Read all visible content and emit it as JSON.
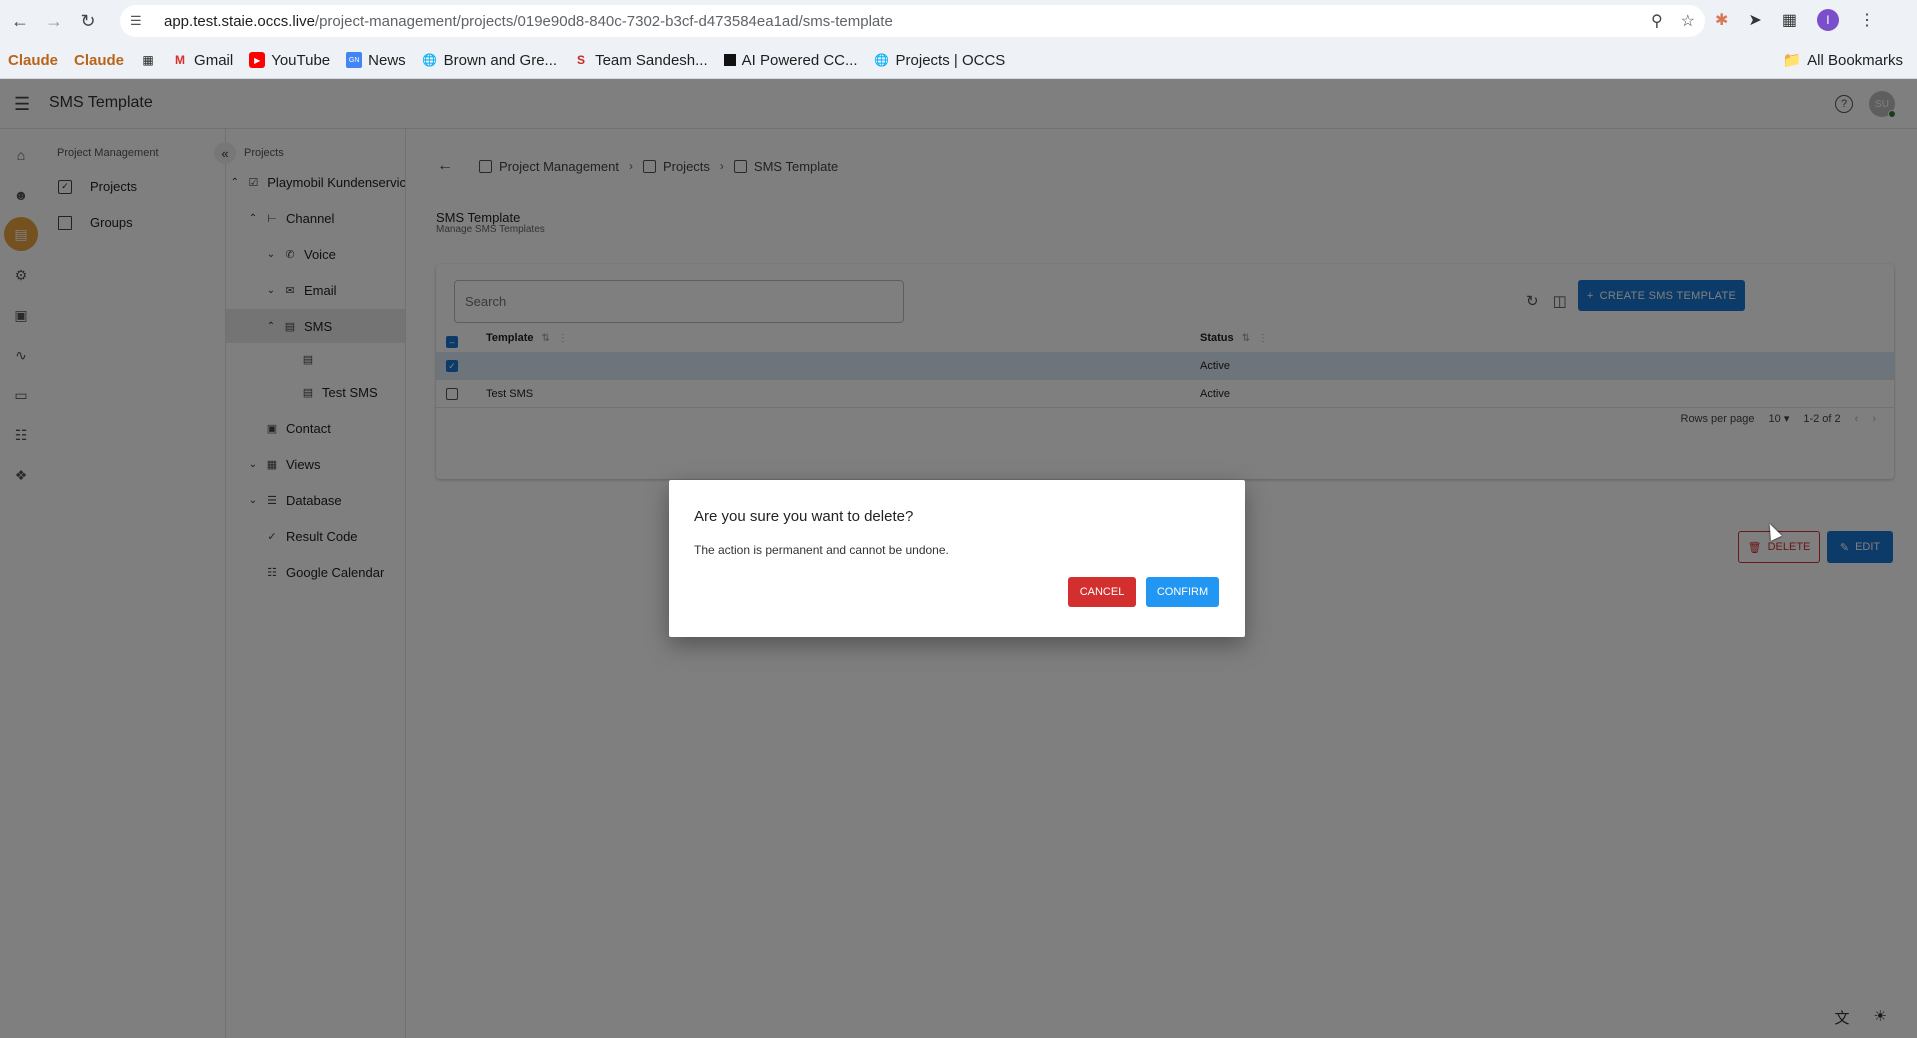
{
  "browser": {
    "url_domain": "app.test.staie.occs.live",
    "url_path": "/project-management/projects/019e90d8-840c-7302-b3cf-d473584ea1ad/sms-template",
    "profile_initial": "I",
    "bookmarks": [
      {
        "label": "Claude",
        "icon": "claude-icon"
      },
      {
        "label": "Claude",
        "icon": "claude-icon"
      },
      {
        "label": "",
        "icon": "apps-grid-icon"
      },
      {
        "label": "Gmail",
        "icon": "gmail-icon"
      },
      {
        "label": "YouTube",
        "icon": "youtube-icon"
      },
      {
        "label": "News",
        "icon": "news-icon"
      },
      {
        "label": "Brown and Gre...",
        "icon": "globe-icon"
      },
      {
        "label": "Team Sandesh...",
        "icon": "sandesh-icon"
      },
      {
        "label": "AI Powered CC...",
        "icon": "black-square-icon"
      },
      {
        "label": "Projects | OCCS",
        "icon": "globe-icon"
      }
    ],
    "all_bookmarks": "All Bookmarks"
  },
  "app": {
    "title": "SMS Template",
    "avatar_initials": "SU"
  },
  "pm_panel": {
    "heading": "Project Management",
    "items": [
      {
        "label": "Projects",
        "icon": "checkbox-icon"
      },
      {
        "label": "Groups",
        "icon": "folder-icon"
      }
    ]
  },
  "tree": {
    "heading": "Projects",
    "rows": [
      {
        "label": "Playmobil Kundenservic",
        "chev": "^",
        "icon": "checkbox-icon"
      },
      {
        "label": "Channel",
        "chev": "^",
        "icon": "channel-icon"
      },
      {
        "label": "Voice",
        "chev": "v",
        "icon": "phone-icon"
      },
      {
        "label": "Email",
        "chev": "v",
        "icon": "mail-icon"
      },
      {
        "label": "SMS",
        "chev": "^",
        "icon": "sms-icon"
      },
      {
        "label": "",
        "chev": "",
        "icon": "sms-icon"
      },
      {
        "label": "Test SMS",
        "chev": "",
        "icon": "sms-icon"
      },
      {
        "label": "Contact",
        "chev": "",
        "icon": "contact-icon"
      },
      {
        "label": "Views",
        "chev": "v",
        "icon": "grid-icon"
      },
      {
        "label": "Database",
        "chev": "v",
        "icon": "list-icon"
      },
      {
        "label": "Result Code",
        "chev": "",
        "icon": "check-icon"
      },
      {
        "label": "Google Calendar",
        "chev": "",
        "icon": "calendar-icon"
      }
    ]
  },
  "breadcrumb": {
    "items": [
      "Project Management",
      "Projects",
      "SMS Template"
    ]
  },
  "page": {
    "title": "SMS Template",
    "subtitle": "Manage SMS Templates"
  },
  "table": {
    "search_placeholder": "Search",
    "create_label": "CREATE SMS TEMPLATE",
    "columns": [
      "Template",
      "Status"
    ],
    "rows": [
      {
        "template": "",
        "status": "Active",
        "selected": true
      },
      {
        "template": "Test SMS",
        "status": "Active",
        "selected": false
      }
    ],
    "rows_per_page_label": "Rows per page",
    "rows_per_page": "10",
    "range": "1-2 of 2"
  },
  "actions": {
    "delete_label": "DELETE",
    "edit_label": "EDIT"
  },
  "dialog": {
    "title": "Are you sure you want to delete?",
    "body": "The action is permanent and cannot be undone.",
    "cancel_label": "CANCEL",
    "confirm_label": "CONFIRM"
  },
  "colors": {
    "primary": "#1976d2",
    "danger": "#d32f2f",
    "confirm": "#2196f3",
    "active_rail": "#e8a33d"
  }
}
